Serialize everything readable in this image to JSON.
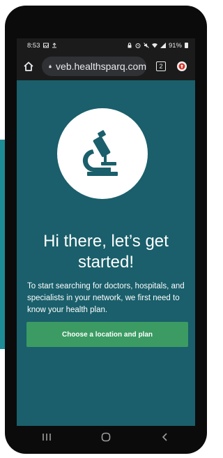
{
  "status_bar": {
    "time": "8:53",
    "battery": "91%"
  },
  "browser": {
    "url": "veb.healthsparq.com",
    "tab_count": "2"
  },
  "page": {
    "hero_icon": "microscope-icon",
    "heading": "Hi there, let’s get started!",
    "body": "To start searching for doctors, hospitals, and specialists in your network, we first need to know your health plan.",
    "cta_label": "Choose a location and plan"
  },
  "nav": {
    "icons": [
      "recent-apps-icon",
      "home-icon",
      "back-icon"
    ]
  },
  "colors": {
    "page_bg": "#1a5f6b",
    "button": "#3b9b63",
    "accent": "#1e8c94"
  }
}
